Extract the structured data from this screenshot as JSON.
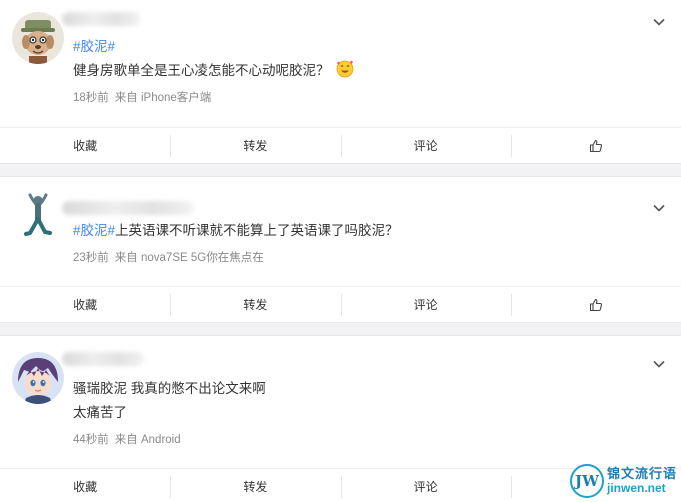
{
  "colors": {
    "topic": "#4287e0",
    "text": "#333333",
    "meta": "#8a8a8a",
    "background": "#f2f2f5"
  },
  "posts": [
    {
      "avatar_icon": "dog-avatar-icon",
      "topic": "#胶泥#",
      "text_lines": [
        "健身房歌单全是王心凌怎能不心动呢胶泥？"
      ],
      "emoji": "smiling-face-with-hearts-emoji",
      "time": "18秒前",
      "source": "来自 iPhone客户端",
      "actions": {
        "favorite": "收藏",
        "repost": "转发",
        "comment": "评论",
        "like_icon": "thumbs-up-icon"
      }
    },
    {
      "avatar_icon": "stretching-person-avatar-icon",
      "topic": "#胶泥#",
      "text_lines": [
        "上英语课不听课就不能算上了英语课了吗胶泥？"
      ],
      "time": "23秒前",
      "source": "来自 nova7SE 5G你在焦点在",
      "actions": {
        "favorite": "收藏",
        "repost": "转发",
        "comment": "评论",
        "like_icon": "thumbs-up-icon"
      }
    },
    {
      "avatar_icon": "anime-boy-avatar-icon",
      "text_lines": [
        "骚瑞胶泥 我真的憋不出论文来啊",
        "太痛苦了"
      ],
      "time": "44秒前",
      "source": "来自 Android",
      "actions": {
        "favorite": "收藏",
        "repost": "转发",
        "comment": "评论"
      }
    }
  ],
  "watermark": {
    "logo": "JW",
    "name_cn": "锦文流行语",
    "name_en": "jinwen.net"
  }
}
